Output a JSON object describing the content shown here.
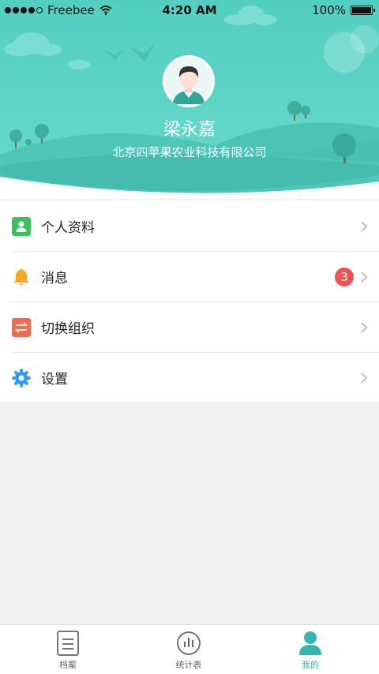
{
  "status_bar": {
    "carrier": "Freebee",
    "time": "4:20 AM",
    "battery": "100%",
    "signal_icon": "signal-dots-icon",
    "wifi_icon": "wifi-icon",
    "battery_icon": "battery-icon"
  },
  "profile": {
    "name": "梁永嘉",
    "organization": "北京四苹果农业科技有限公司",
    "avatar_icon": "user-avatar-icon"
  },
  "menu": {
    "items": [
      {
        "label": "个人资料",
        "icon": "person-card-icon",
        "icon_color": "#3cc05e"
      },
      {
        "label": "消息",
        "icon": "bell-icon",
        "icon_color": "#f5a623",
        "badge": "3"
      },
      {
        "label": "切换组织",
        "icon": "swap-icon",
        "icon_color": "#f26b4f"
      },
      {
        "label": "设置",
        "icon": "gear-icon",
        "icon_color": "#2e9bf0"
      }
    ]
  },
  "tabbar": {
    "tabs": [
      {
        "label": "档案",
        "icon": "document-icon"
      },
      {
        "label": "统计表",
        "icon": "bar-chart-icon"
      },
      {
        "label": "我的",
        "icon": "person-icon",
        "active": true
      }
    ]
  },
  "colors": {
    "header_teal": "#5ed3c5",
    "accent": "#35b8ac",
    "badge_red": "#ef5350"
  }
}
